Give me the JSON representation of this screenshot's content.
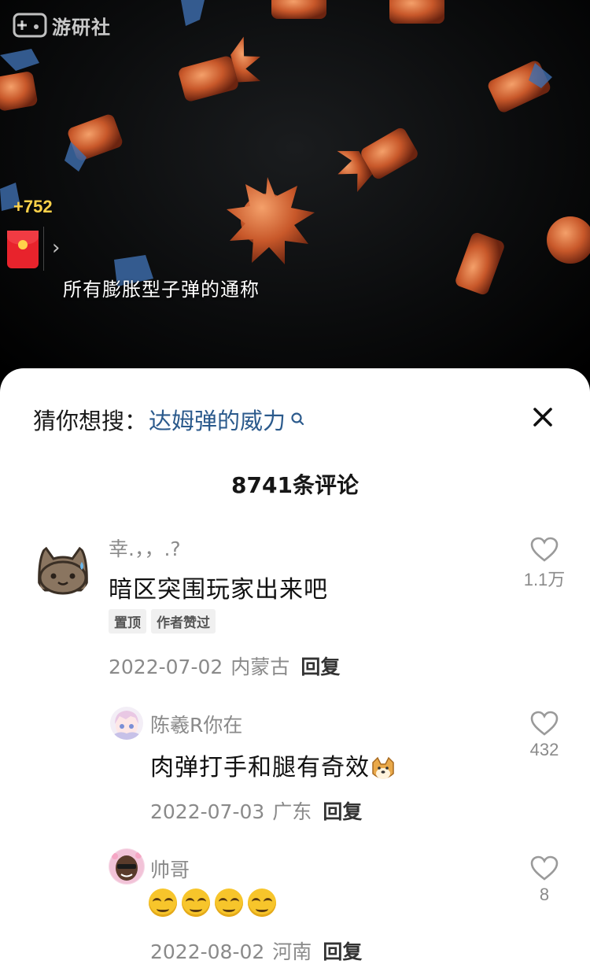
{
  "video": {
    "watermark": "游研社",
    "coin_bonus": "+752",
    "subtitle": "所有膨胀型子弹的通称"
  },
  "sheet": {
    "suggest_prefix": "猜你想搜：",
    "suggest_keyword": "达姆弹的威力",
    "comment_count": "8741条评论"
  },
  "comments": [
    {
      "user": "幸.，，.?",
      "text": "暗区突围玩家出来吧",
      "tags": [
        "置顶",
        "作者赞过"
      ],
      "date": "2022-07-02",
      "location": "内蒙古",
      "reply": "回复",
      "likes": "1.1万",
      "avatar": "cat-avatar"
    },
    {
      "user": "陈羲R你在",
      "text": "肉弹打手和腿有奇效",
      "date": "2022-07-03",
      "location": "广东",
      "reply": "回复",
      "likes": "432",
      "avatar": "anime-girl-avatar"
    },
    {
      "user": "帅哥",
      "text": "",
      "date": "2022-08-02",
      "location": "河南",
      "reply": "回复",
      "likes": "8",
      "avatar": "face-avatar",
      "emoji_count": 4
    }
  ],
  "colors": {
    "keyword": "#2b5a8c",
    "coin": "#ffd24a",
    "redpacket": "#e8232c"
  }
}
